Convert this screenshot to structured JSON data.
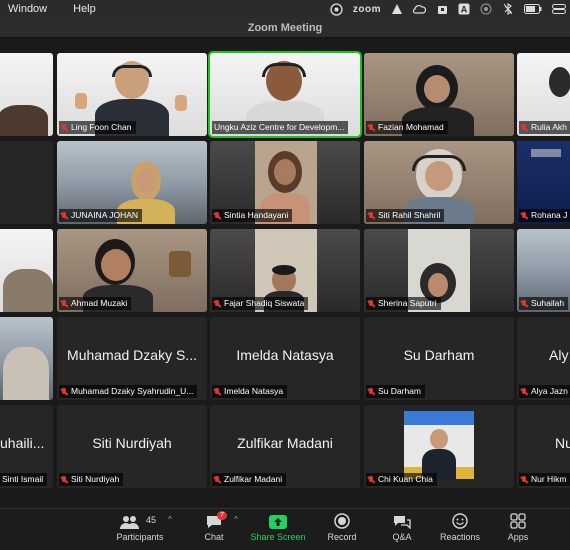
{
  "menubar": {
    "items": [
      "Window",
      "Help"
    ],
    "zoom_label": "zoom"
  },
  "window": {
    "title": "Zoom Meeting"
  },
  "tiles": [
    {
      "name": "",
      "bigname": "",
      "video": true
    },
    {
      "name": "Ling Foon Chan",
      "bigname": "",
      "video": true
    },
    {
      "name": "Ungku Aziz Centre for Developm...",
      "bigname": "",
      "video": true,
      "active": true
    },
    {
      "name": "Fazian Mohamad",
      "bigname": "",
      "video": true
    },
    {
      "name": "Rulia Akh",
      "bigname": "",
      "video": true
    },
    {
      "name": "",
      "bigname": "",
      "video": false
    },
    {
      "name": "JUNAINA JOHAN",
      "bigname": "",
      "video": true
    },
    {
      "name": "Sintia Handayani",
      "bigname": "",
      "video": true
    },
    {
      "name": "Siti Rahil Shahril",
      "bigname": "",
      "video": true
    },
    {
      "name": "Rohana J",
      "bigname": "",
      "video": true
    },
    {
      "name": "",
      "bigname": "",
      "video": true
    },
    {
      "name": "Ahmad Muzaki",
      "bigname": "",
      "video": true
    },
    {
      "name": "Fajar Shadiq Siswata",
      "bigname": "",
      "video": true
    },
    {
      "name": "Sherina Saputri",
      "bigname": "",
      "video": true
    },
    {
      "name": "Suhailah",
      "bigname": "",
      "video": true
    },
    {
      "name": "",
      "bigname": "",
      "video": true
    },
    {
      "name": "Muhamad Dzaky Syahrudin_U...",
      "bigname": "Muhamad Dzaky S...",
      "video": false
    },
    {
      "name": "Imelda Natasya",
      "bigname": "Imelda Natasya",
      "video": false
    },
    {
      "name": "Su Darham",
      "bigname": "Su Darham",
      "video": false
    },
    {
      "name": "Alya Jazn",
      "bigname": "Aly",
      "video": false
    },
    {
      "name": "Sinti Ismail",
      "bigname": "uhaili...",
      "video": false
    },
    {
      "name": "Siti Nurdiyah",
      "bigname": "Siti Nurdiyah",
      "video": false
    },
    {
      "name": "Zulfikar Madani",
      "bigname": "Zulfikar Madani",
      "video": false
    },
    {
      "name": "Chi Kuan Chia",
      "bigname": "",
      "video": true
    },
    {
      "name": "Nur Hikm",
      "bigname": "Nu",
      "video": false
    }
  ],
  "toolbar": {
    "participants": {
      "label": "Participants",
      "count": "45"
    },
    "chat": {
      "label": "Chat",
      "badge": "7"
    },
    "share": {
      "label": "Share Screen"
    },
    "record": {
      "label": "Record"
    },
    "qa": {
      "label": "Q&A"
    },
    "reactions": {
      "label": "Reactions"
    },
    "apps": {
      "label": "Apps"
    }
  },
  "colors": {
    "accent_green": "#23d160",
    "active_border": "#1bc41b",
    "muted_red": "#e03434"
  }
}
